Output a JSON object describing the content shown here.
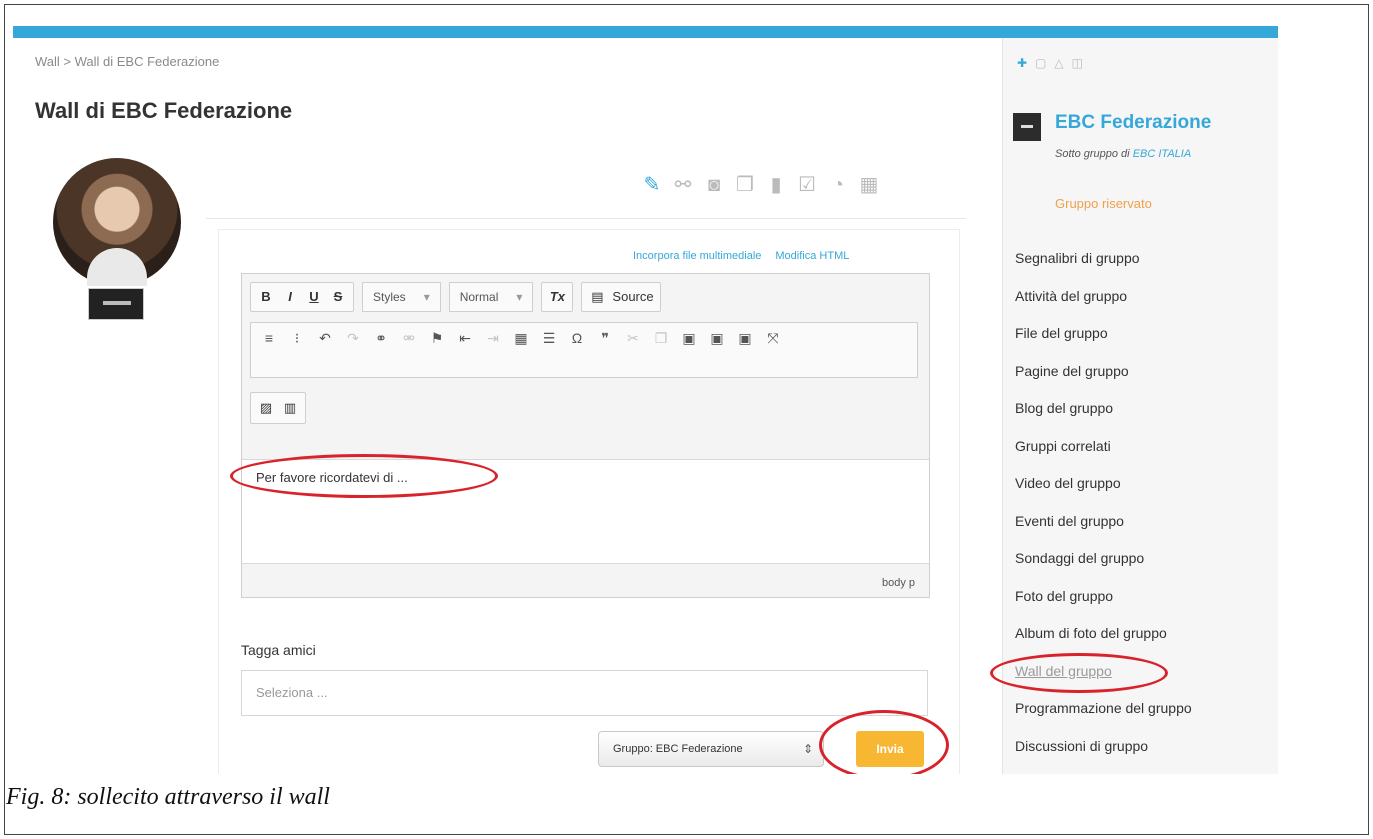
{
  "breadcrumb": "Wall > Wall di EBC Federazione",
  "page_title": "Wall di EBC Federazione",
  "post_tools": [
    "pencil-icon",
    "link-icon",
    "camera-icon",
    "files-icon",
    "video-icon",
    "checkbox-icon",
    "rss-icon",
    "calendar-icon"
  ],
  "editor": {
    "embed_link": "Incorpora file multimediale",
    "html_link": "Modifica HTML",
    "bold": "B",
    "italic": "I",
    "underline": "U",
    "strike": "S",
    "styles_label": "Styles",
    "format_label": "Normal",
    "clear_format": "Tx",
    "source_label": "Source",
    "body_text": "Per favore ricordatevi di ...",
    "status_path": "body  p"
  },
  "tag": {
    "label": "Tagga amici",
    "placeholder": "Seleziona ..."
  },
  "group_select_value": "Gruppo: EBC Federazione",
  "send_label": "Invia",
  "sidebar": {
    "group_name": "EBC Federazione",
    "sub_prefix": "Sotto gruppo di",
    "parent_group": "EBC ITALIA",
    "status": "Gruppo riservato",
    "menu": [
      "Segnalibri di gruppo",
      "Attività del gruppo",
      "File del gruppo",
      "Pagine del gruppo",
      "Blog del gruppo",
      "Gruppi correlati",
      "Video del gruppo",
      "Eventi del gruppo",
      "Sondaggi del gruppo",
      "Foto del gruppo",
      "Album di foto del gruppo",
      "Wall del gruppo",
      "Programmazione del gruppo",
      "Discussioni di gruppo"
    ]
  },
  "caption": "Fig. 8: sollecito attraverso il wall",
  "colors": {
    "accent": "#35a8d9",
    "send": "#f7b733",
    "highlight_ring": "#d8232a",
    "status": "#f0a04b"
  }
}
